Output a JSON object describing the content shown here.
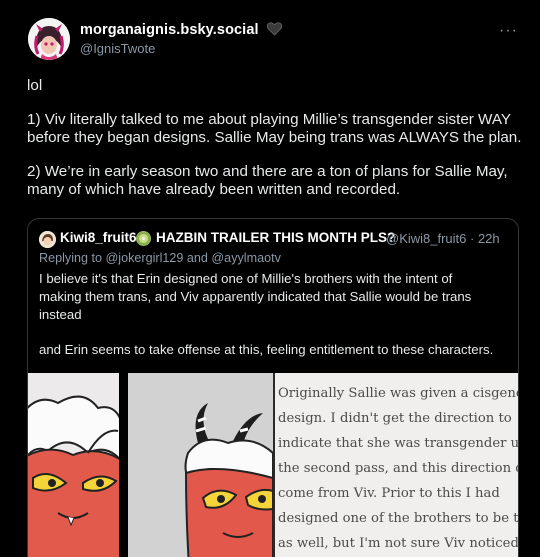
{
  "author": {
    "display_name": "morganaignis.bsky.social",
    "handle": "@IgnisTwote"
  },
  "icons": {
    "more": "ellipsis-icon",
    "heart": "black-heart-icon"
  },
  "post": {
    "lines": [
      "lol",
      "1) Viv literally talked to me about playing Millie’s transgender sister WAY",
      "before they began designs. Sallie May being trans was ALWAYS the plan.",
      "2) We’re in early season two and there are a ton of plans for Sallie May,",
      "many of which have already been written and recorded."
    ]
  },
  "quote": {
    "name": "Kiwi8_fruit6",
    "title": "HAZBIN TRAILER THIS MONTH PLS?",
    "handle_time": "@Kiwi8_fruit6 · 22h",
    "replying": "Replying to @jokergirl129 and @ayylmaotv",
    "lines": [
      "I believe it's that Erin designed one of Millie's brothers with the intent of",
      "making them trans, and Viv apparently indicated that Sallie would be trans",
      "instead",
      "and Erin seems to take offense at this, feeling entitlement to these characters."
    ]
  },
  "document_image": {
    "lines": [
      "Originally Sallie was given a cisgender",
      "design. I didn't get the direction to",
      "indicate that she was transgender until",
      "the second pass, and this direction did",
      "come from Viv. Prior to this I had",
      "designed one of the brothers to be trans",
      "as well, but I'm not sure Viv noticed as"
    ]
  },
  "colors": {
    "background": "#000000",
    "text": "#e7e9ea",
    "secondary": "#8b98a5",
    "border": "#333639"
  }
}
